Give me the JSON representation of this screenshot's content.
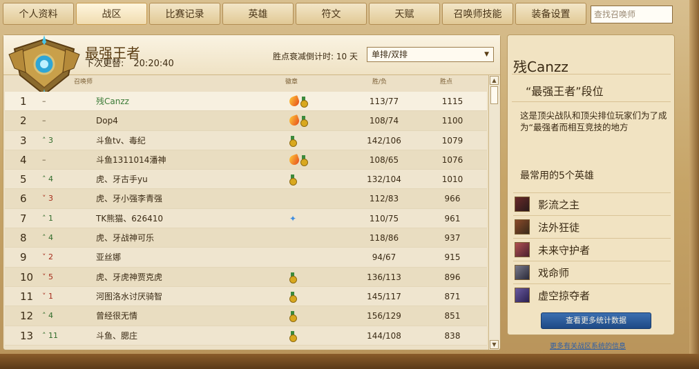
{
  "nav": {
    "tabs": [
      "个人资料",
      "战区",
      "比赛记录",
      "英雄",
      "符文",
      "天赋",
      "召唤师技能",
      "装备设置"
    ],
    "active_index": 1,
    "search_placeholder": "查找召唤师"
  },
  "header": {
    "title": "最强王者",
    "update_label": "下次更替:",
    "update_time": "20:20:40",
    "decay_label": "胜点衰减倒计时: 10 天",
    "queue_select": "单排/双排"
  },
  "columns": {
    "summoner": "召唤师",
    "medal": "徽章",
    "wl": "胜/负",
    "lp": "胜点"
  },
  "rows": [
    {
      "rank": "1",
      "change": "–",
      "dir": "none",
      "name": "残Canzz",
      "medals": [
        "flame",
        "medal"
      ],
      "wl": "113/77",
      "lp": "1115",
      "me": true
    },
    {
      "rank": "2",
      "change": "–",
      "dir": "none",
      "name": "Dop4",
      "medals": [
        "flame",
        "medal"
      ],
      "wl": "108/74",
      "lp": "1100"
    },
    {
      "rank": "3",
      "change": "3",
      "dir": "up",
      "name": "斗鱼tv、毒纪",
      "medals": [
        "medal"
      ],
      "wl": "142/106",
      "lp": "1079"
    },
    {
      "rank": "4",
      "change": "–",
      "dir": "none",
      "name": "斗鱼1311014潘神",
      "medals": [
        "flame",
        "medal"
      ],
      "wl": "108/65",
      "lp": "1076"
    },
    {
      "rank": "5",
      "change": "4",
      "dir": "up",
      "name": "虎、牙古手yu",
      "medals": [
        "medal"
      ],
      "wl": "132/104",
      "lp": "1010"
    },
    {
      "rank": "6",
      "change": "3",
      "dir": "down",
      "name": "虎、牙小强李青强",
      "medals": [],
      "wl": "112/83",
      "lp": "966"
    },
    {
      "rank": "7",
      "change": "1",
      "dir": "up",
      "name": "TK熊猫、626410",
      "medals": [
        "star"
      ],
      "wl": "110/75",
      "lp": "961"
    },
    {
      "rank": "8",
      "change": "4",
      "dir": "up",
      "name": "虎、牙战神可乐",
      "medals": [],
      "wl": "118/86",
      "lp": "937"
    },
    {
      "rank": "9",
      "change": "2",
      "dir": "down",
      "name": "亚丝娜",
      "medals": [],
      "wl": "94/67",
      "lp": "915"
    },
    {
      "rank": "10",
      "change": "5",
      "dir": "down",
      "name": "虎、牙虎神贾克虎",
      "medals": [
        "medal"
      ],
      "wl": "136/113",
      "lp": "896"
    },
    {
      "rank": "11",
      "change": "1",
      "dir": "down",
      "name": "河图洛水讨厌骑智",
      "medals": [
        "medal"
      ],
      "wl": "145/117",
      "lp": "871"
    },
    {
      "rank": "12",
      "change": "4",
      "dir": "up",
      "name": "曾经很无情",
      "medals": [
        "medal"
      ],
      "wl": "156/129",
      "lp": "851"
    },
    {
      "rank": "13",
      "change": "11",
      "dir": "up",
      "name": "斗鱼、腮庄",
      "medals": [
        "medal"
      ],
      "wl": "144/108",
      "lp": "838"
    }
  ],
  "side": {
    "name": "残Canzz",
    "tier": "“最强王者”段位",
    "description": "这是顶尖战队和顶尖排位玩家们为了成为“最强者而相互竞技的地方",
    "top5_label": "最常用的5个英雄",
    "champions": [
      "影流之主",
      "法外狂徒",
      "未来守护者",
      "戏命师",
      "虚空掠夺者"
    ],
    "more_button": "查看更多统计数据",
    "link": "更多有关战区系统的信息"
  },
  "colors": {
    "accent_blue": "#1e4a86",
    "up": "#2f6b2a",
    "down": "#a52a1a",
    "me_name": "#3a7a36"
  }
}
